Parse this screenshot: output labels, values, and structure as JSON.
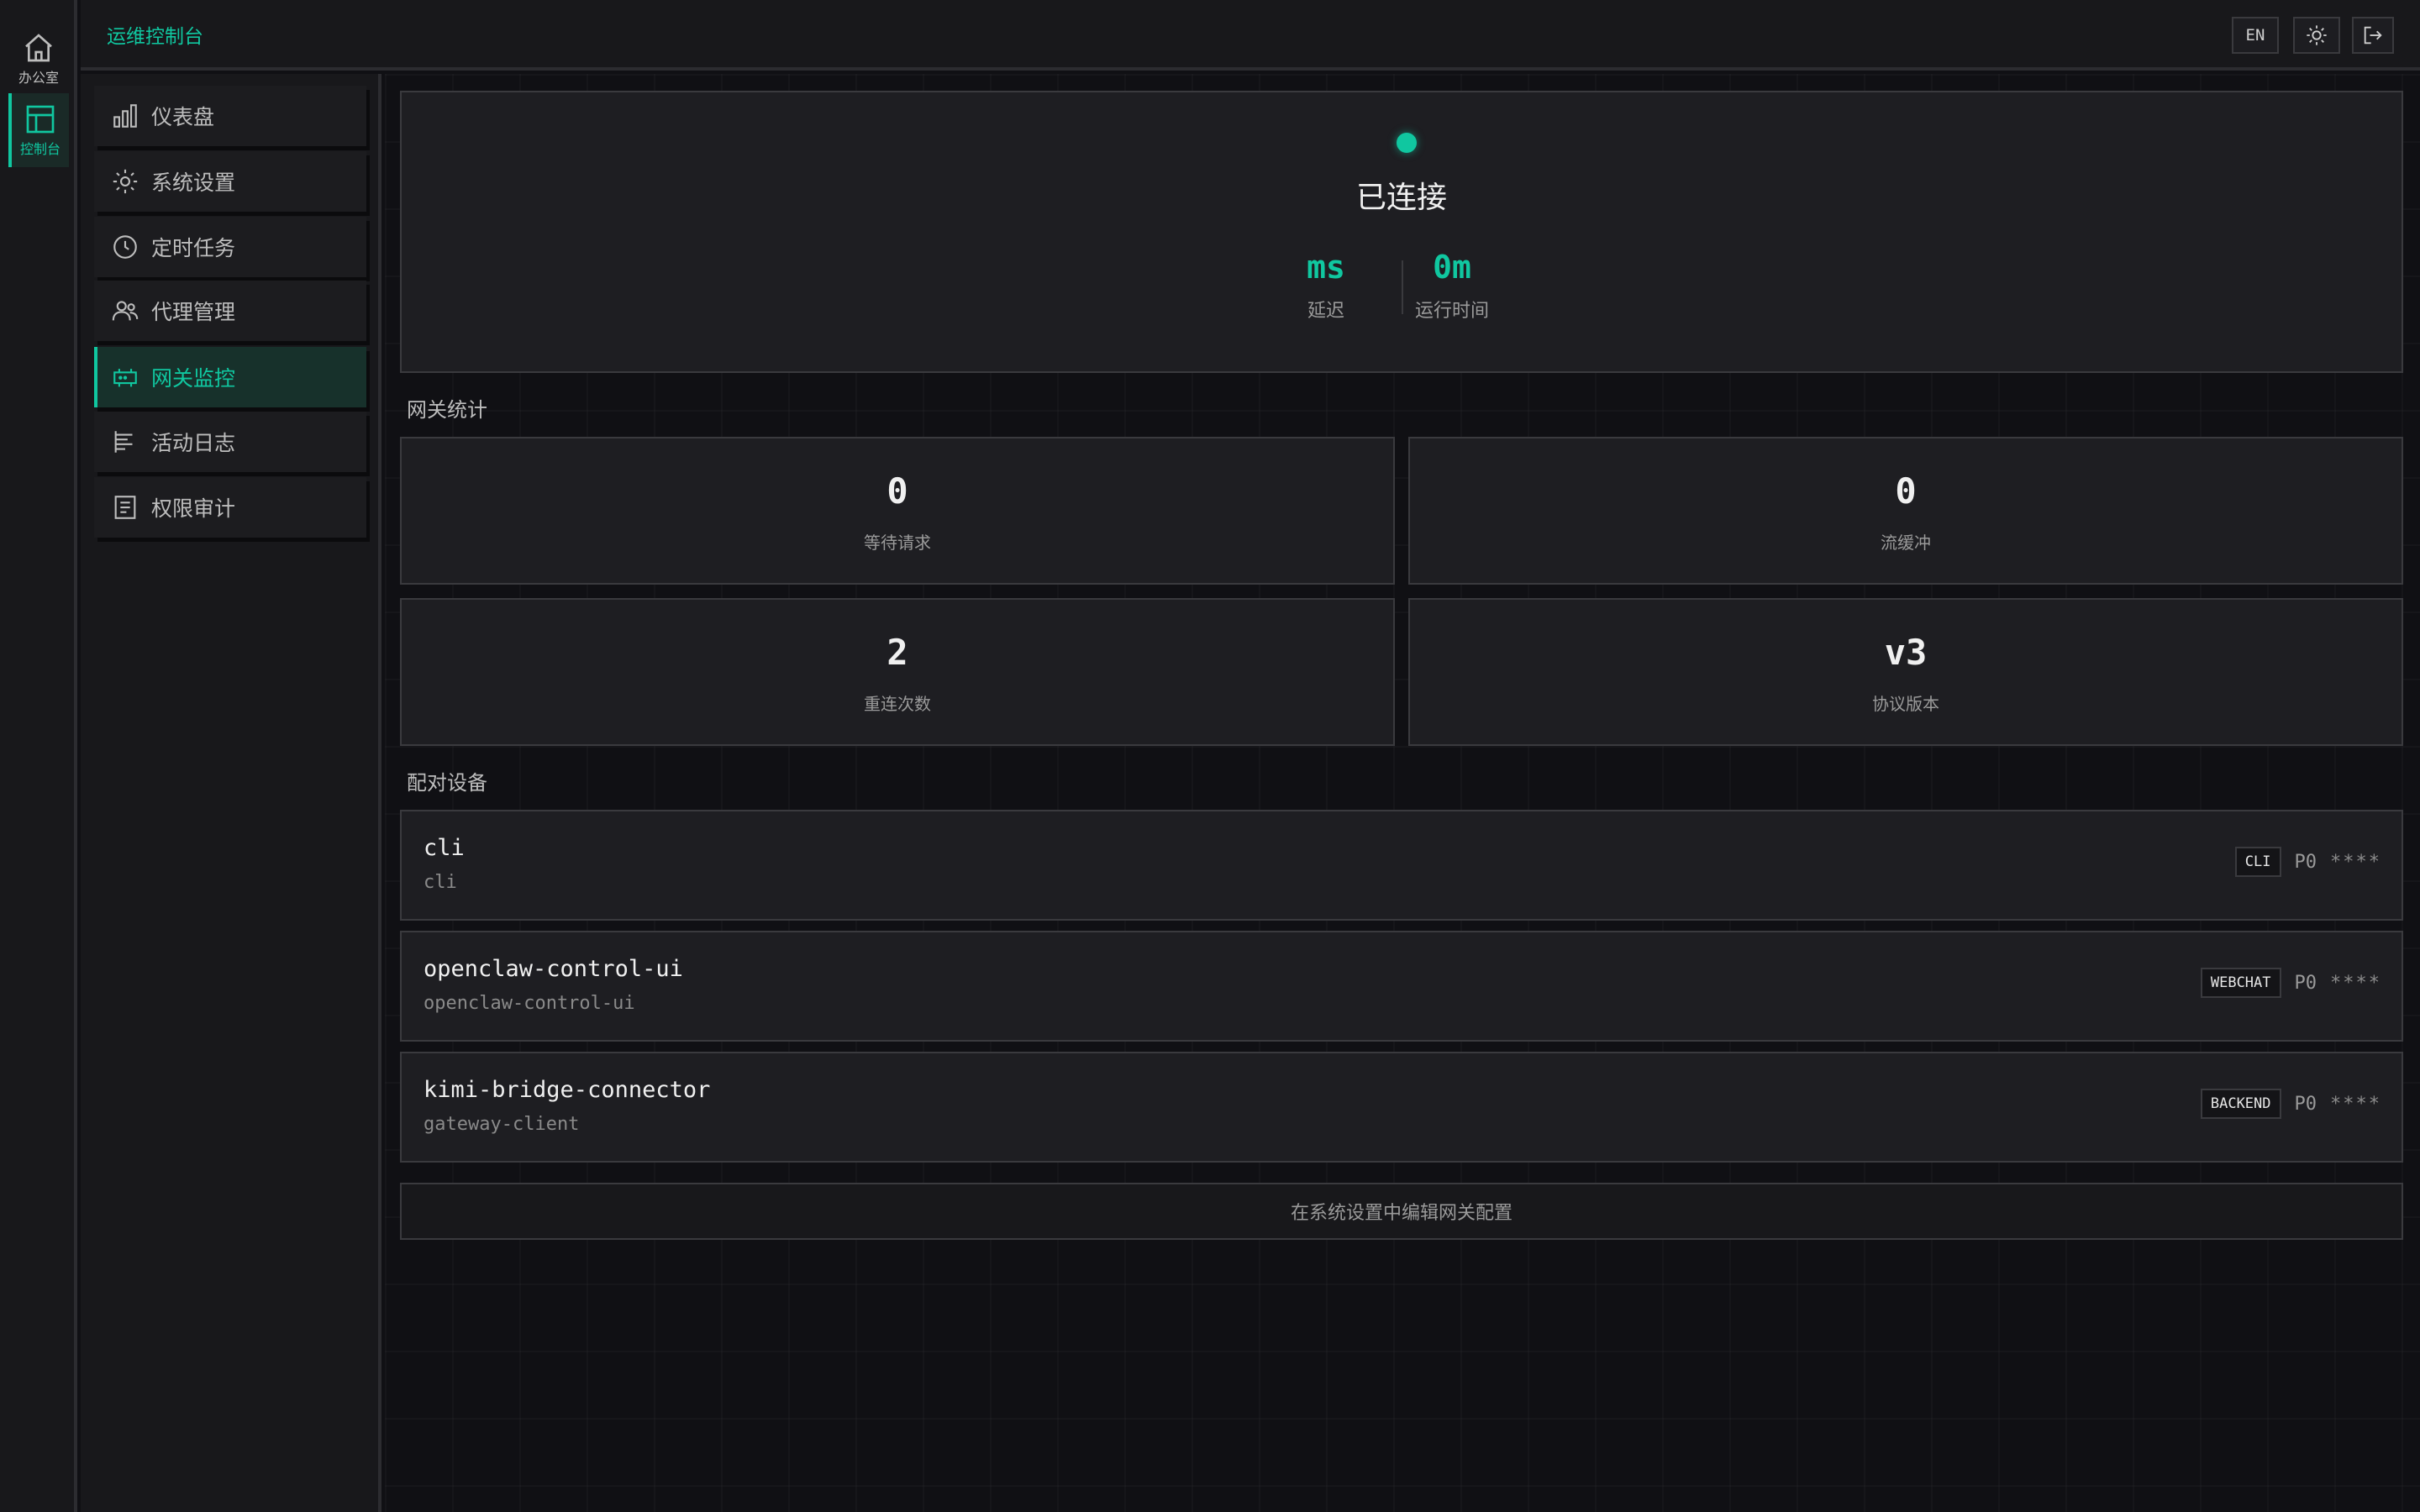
{
  "rail": {
    "office_label": "办公室",
    "console_label": "控制台"
  },
  "header": {
    "title": "运维控制台",
    "lang_button": "EN"
  },
  "sidebar": {
    "items": [
      {
        "label": "仪表盘",
        "icon": "bar-chart-icon"
      },
      {
        "label": "系统设置",
        "icon": "gear-icon"
      },
      {
        "label": "定时任务",
        "icon": "clock-icon"
      },
      {
        "label": "代理管理",
        "icon": "users-icon"
      },
      {
        "label": "网关监控",
        "icon": "gateway-icon",
        "active": true
      },
      {
        "label": "活动日志",
        "icon": "list-icon"
      },
      {
        "label": "权限审计",
        "icon": "document-icon"
      }
    ]
  },
  "status": {
    "state": "已连接",
    "latency_value": "ms",
    "latency_label": "延迟",
    "uptime_value": "0m",
    "uptime_label": "运行时间"
  },
  "stats": {
    "title": "网关统计",
    "cards": [
      {
        "value": "0",
        "label": "等待请求"
      },
      {
        "value": "0",
        "label": "流缓冲"
      },
      {
        "value": "2",
        "label": "重连次数"
      },
      {
        "value": "v3",
        "label": "协议版本"
      }
    ]
  },
  "devices": {
    "title": "配对设备",
    "items": [
      {
        "name": "cli",
        "client": "cli",
        "badge": "CLI",
        "priority": "P0",
        "token": "****"
      },
      {
        "name": "openclaw-control-ui",
        "client": "openclaw-control-ui",
        "badge": "WEBCHAT",
        "priority": "P0",
        "token": "****"
      },
      {
        "name": "kimi-bridge-connector",
        "client": "gateway-client",
        "badge": "BACKEND",
        "priority": "P0",
        "token": "****"
      }
    ]
  },
  "footer": {
    "edit_link": "在系统设置中编辑网关配置"
  },
  "colors": {
    "accent": "#10c7a0",
    "background": "#101014",
    "panel": "#1e1e22"
  }
}
